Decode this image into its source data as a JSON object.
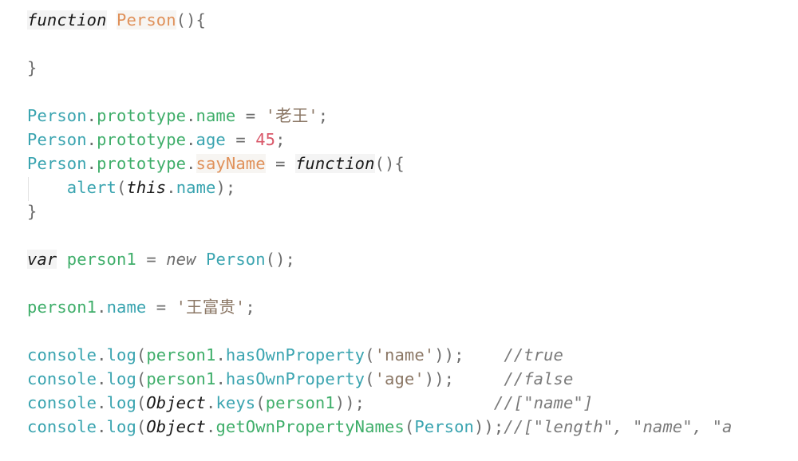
{
  "editor": {
    "language": "javascript",
    "lines": [
      {
        "tokens": [
          "function",
          " ",
          "Person",
          "(){"
        ]
      },
      {
        "tokens": [
          "}"
        ]
      },
      {
        "tokens": [
          "Person",
          ".",
          "prototype",
          ".",
          "name",
          " = ",
          "'老王'",
          ";"
        ]
      },
      {
        "tokens": [
          "Person",
          ".",
          "prototype",
          ".",
          "age",
          " = ",
          "45",
          ";"
        ]
      },
      {
        "tokens": [
          "Person",
          ".",
          "prototype",
          ".",
          "sayName",
          " = ",
          "function",
          "(){"
        ]
      },
      {
        "tokens": [
          "    ",
          "alert",
          "(",
          "this",
          ".",
          "name",
          ");"
        ]
      },
      {
        "tokens": [
          "}"
        ]
      },
      {
        "tokens": [
          "var",
          " ",
          "person1",
          " = ",
          "new",
          " ",
          "Person",
          "();"
        ]
      },
      {
        "tokens": [
          "person1",
          ".",
          "name",
          " = ",
          "'王富贵'",
          ";"
        ]
      },
      {
        "tokens": [
          "console",
          ".",
          "log",
          "(",
          "person1",
          ".",
          "hasOwnProperty",
          "(",
          "'name'",
          "));",
          "    ",
          "//true"
        ]
      },
      {
        "tokens": [
          "console",
          ".",
          "log",
          "(",
          "person1",
          ".",
          "hasOwnProperty",
          "(",
          "'age'",
          "));",
          "     ",
          "//false"
        ]
      },
      {
        "tokens": [
          "console",
          ".",
          "log",
          "(",
          "Object",
          ".",
          "keys",
          "(",
          "person1",
          "));",
          "             ",
          "//[\"name\"]"
        ]
      },
      {
        "tokens": [
          "console",
          ".",
          "log",
          "(",
          "Object",
          ".",
          "getOwnPropertyNames",
          "(",
          "Person",
          "));",
          "//[\"length\", \"name\", \"a"
        ]
      }
    ]
  }
}
